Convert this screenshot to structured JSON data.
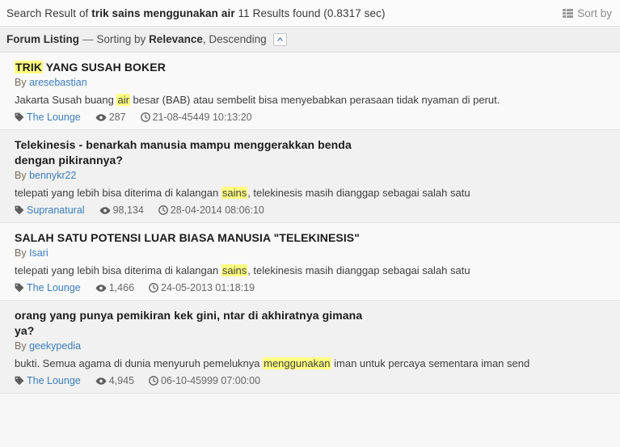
{
  "header": {
    "prefix": "Search Result of",
    "query": "trik sains menggunakan air",
    "results_text": "11 Results found (0.8317 sec)",
    "sort_by_label": "Sort by",
    "sort_by_icon": "th-list-icon"
  },
  "listing": {
    "title": "Forum Listing",
    "dash": "—",
    "sorting_prefix": "Sorting by",
    "sort_field": "Relevance",
    "sort_direction": ", Descending",
    "collapse_icon": "chevron-up-icon"
  },
  "meta_icons": {
    "category": "tag-icon",
    "views": "eye-icon",
    "date": "clock-icon"
  },
  "labels": {
    "by": "By"
  },
  "colors": {
    "highlight": "#ffff80",
    "link": "#3b7dbd",
    "row_odd": "#f9f9f9",
    "row_even": "#f1f1f1",
    "header_bg": "#fbfbfb",
    "subheader_bg": "#efefef"
  },
  "results": [
    {
      "title_pre": "",
      "title_mark": "TRIK",
      "title_post": " YANG SUSAH BOKER",
      "author": "aresebastian",
      "snippet_pre": "Jakarta Susah buang ",
      "snippet_mark": "air",
      "snippet_post": " besar (BAB) atau sembelit bisa menyebabkan perasaan tidak nyaman di perut.",
      "category": "The Lounge",
      "views": "287",
      "date": "21-08-45449 10:13:20"
    },
    {
      "title_pre": "Telekinesis - benarkah manusia mampu menggerakkan benda dengan pikirannya?",
      "title_mark": "",
      "title_post": "",
      "author": "bennykr22",
      "snippet_pre": "telepati yang lebih bisa diterima di kalangan ",
      "snippet_mark": "sains",
      "snippet_post": ", telekinesis masih dianggap sebagai salah satu",
      "category": "Supranatural",
      "views": "98,134",
      "date": "28-04-2014 08:06:10"
    },
    {
      "title_pre": "SALAH SATU POTENSI LUAR BIASA MANUSIA \"TELEKINESIS\"",
      "title_mark": "",
      "title_post": "",
      "author": "Isari",
      "snippet_pre": "telepati yang lebih bisa diterima di kalangan ",
      "snippet_mark": "sains",
      "snippet_post": ", telekinesis masih dianggap sebagai salah satu",
      "category": "The Lounge",
      "views": "1,466",
      "date": "24-05-2013 01:18:19"
    },
    {
      "title_pre": "orang yang punya pemikiran kek gini, ntar di akhiratnya gimana ya?",
      "title_mark": "",
      "title_post": "",
      "author": "geekypedia",
      "snippet_pre": "bukti. Semua agama di dunia menyuruh pemeluknya ",
      "snippet_mark": "menggunakan",
      "snippet_post": " iman untuk percaya sementara iman send",
      "category": "The Lounge",
      "views": "4,945",
      "date": "06-10-45999 07:00:00"
    }
  ]
}
